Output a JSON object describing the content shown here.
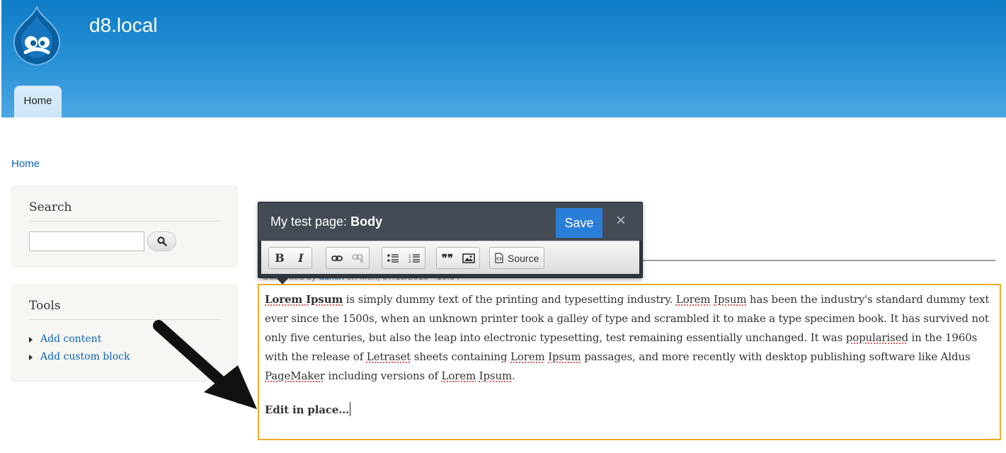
{
  "site": {
    "name": "d8.local",
    "logo_icon": "drupal-drop-icon"
  },
  "nav": {
    "tabs": [
      {
        "label": "Home",
        "active": true
      }
    ]
  },
  "breadcrumb": {
    "home": "Home"
  },
  "sidebar": {
    "search": {
      "title": "Search",
      "placeholder": "",
      "button_icon": "search-icon"
    },
    "tools": {
      "title": "Tools",
      "links": [
        "Add content",
        "Add custom block"
      ]
    }
  },
  "node": {
    "meta_prefix": "Submitted by",
    "meta_author": "admin",
    "meta_suffix": "on Mon, 07/13/2015 - 18:34"
  },
  "editor": {
    "label_prefix": "My test page:",
    "field": "Body",
    "save": "Save",
    "close": "×",
    "toolbar": {
      "bold": "B",
      "italic": "I",
      "link_icon": "link-icon",
      "unlink_icon": "unlink-icon",
      "bulleted_list_icon": "bulleted-list-icon",
      "numbered_list_icon": "numbered-list-icon",
      "blockquote": "❞❞",
      "image_icon": "image-icon",
      "source": "Source"
    },
    "colors": {
      "focus_outline": "#f0a928",
      "save_button": "#2b7ed8",
      "toolbar_bg": "#444b54"
    }
  },
  "body": {
    "p1_bold": "Lorem Ipsum",
    "p1_a": " is simply dummy text of the printing and typesetting industry. ",
    "p1_sp1": "Lorem",
    "p1_b": " ",
    "p1_sp2": "Ipsum",
    "p1_c": " has been the industry's standard dummy text ever since the 1500s, when an unknown printer took a galley of type and scrambled it to make a type specimen book. It has survived not only five centuries, but also the leap into electronic typesetting, test remaining essentially unchanged. It was ",
    "p1_sp3": "popularised",
    "p1_d": " in the 1960s with the release of ",
    "p1_sp4": "Letraset",
    "p1_e": " sheets containing ",
    "p1_sp5": "Lorem",
    "p1_f": " ",
    "p1_sp6": "Ipsum",
    "p1_g": " passages, and more recently with desktop publishing software like Aldus ",
    "p1_sp7": "PageMaker",
    "p1_h": " including versions of ",
    "p1_sp8": "Lorem",
    "p1_i": " ",
    "p1_sp9": "Ipsum",
    "p1_j": ".",
    "p2_bold": "Edit in place…"
  }
}
